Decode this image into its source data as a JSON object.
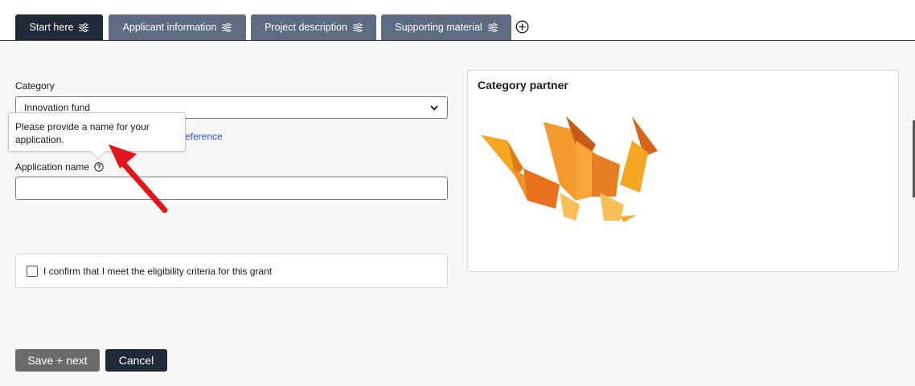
{
  "tabs": [
    {
      "label": "Start here",
      "active": true,
      "icon": "sliders-icon"
    },
    {
      "label": "Applicant information",
      "active": false,
      "icon": "sliders-icon"
    },
    {
      "label": "Project description",
      "active": false,
      "icon": "sliders-icon"
    },
    {
      "label": "Supporting material",
      "active": false,
      "icon": "sliders-icon"
    }
  ],
  "add_tab_icon": "plus-circle-icon",
  "form": {
    "category_label": "Category",
    "category_value": "Innovation fund",
    "help_link_visible": "eference",
    "tooltip_text": "Please provide a name for your application.",
    "application_name_label": "Application name",
    "application_name_value": "",
    "confirm_label": "I confirm that I meet the eligibility criteria for this grant"
  },
  "partner": {
    "title": "Category partner",
    "image": "origami-dragon-logo"
  },
  "buttons": {
    "save_label": "Save + next",
    "cancel_label": "Cancel"
  },
  "colors": {
    "tab_active": "#1f2937",
    "tab_inactive": "#5c6b82",
    "link": "#2b4fd6",
    "annotation_arrow": "#e0161b"
  }
}
